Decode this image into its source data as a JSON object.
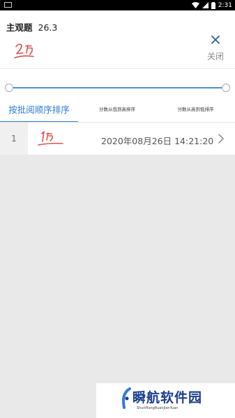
{
  "status_bar": {
    "time": "2:31",
    "icons": [
      "wifi-icon",
      "signal-icon",
      "battery-icon"
    ]
  },
  "header": {
    "title": "主观题",
    "score": "26.3",
    "close_label": "关闭"
  },
  "handwriting": {
    "header_score_text": "2分",
    "row_score_text": "1分",
    "color": "#d9534f"
  },
  "tabs": [
    {
      "label": "按批阅顺序排序",
      "active": true
    },
    {
      "label": "分数从低到高排序",
      "active": false
    },
    {
      "label": "分数从高到低排序",
      "active": false
    }
  ],
  "records": [
    {
      "index": "1",
      "datetime": "2020年08月26日 14:21:20"
    }
  ],
  "watermark": {
    "main": "瞬航软件园",
    "sub": "ShunHangRuanJianYuan"
  },
  "colors": {
    "accent": "#2f7ed8",
    "slider": "#4a90d9",
    "background_gray": "#e9e9e9",
    "watermark_blue": "#1a3d8f"
  }
}
